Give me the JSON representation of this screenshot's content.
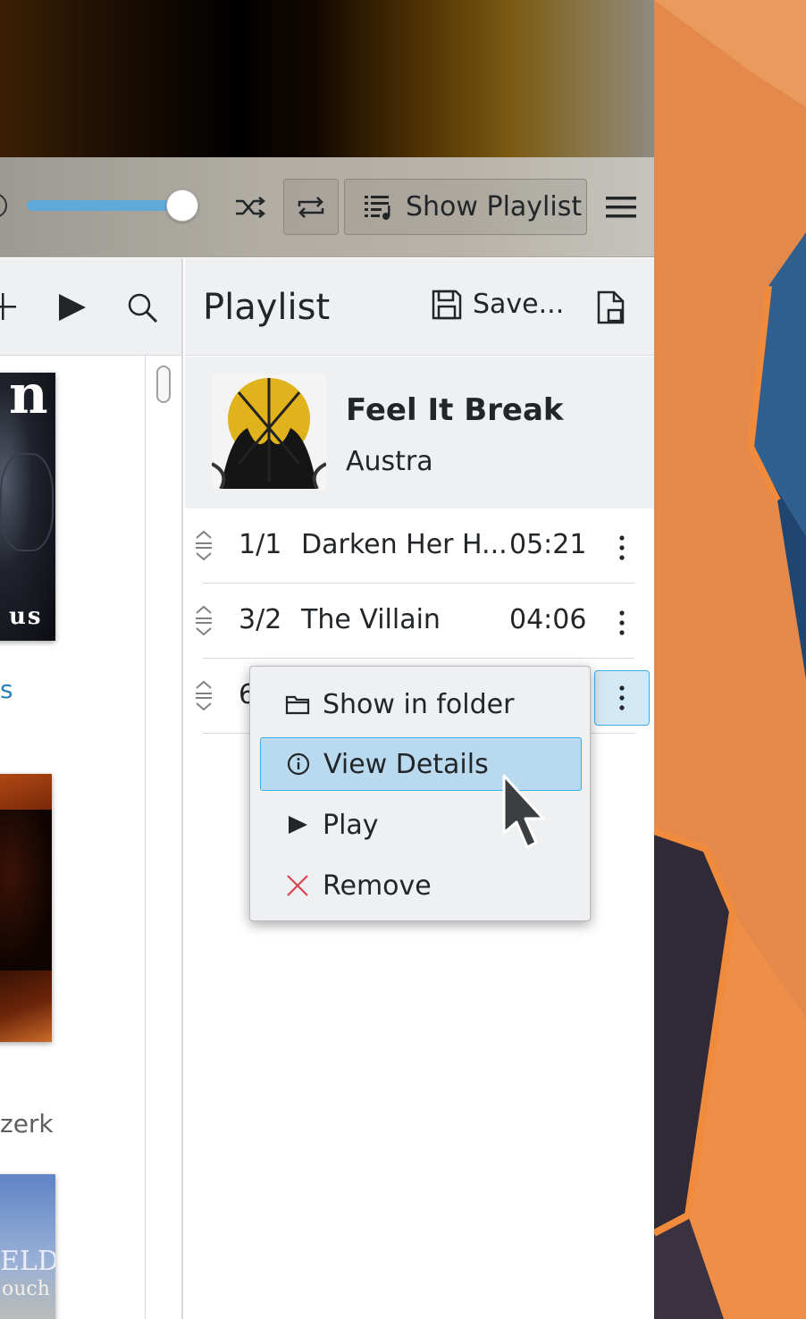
{
  "toolbar": {
    "show_playlist_label": "Show Playlist",
    "volume_level": 0.9
  },
  "left_pane": {
    "caption_partial": "zerk",
    "link_partial": "s",
    "album_1_text": "us",
    "album_3_text_line1": "ELD",
    "album_3_text_line2": "ouch"
  },
  "playlist": {
    "title": "Playlist",
    "save_label": "Save...",
    "now_playing": {
      "title": "Feel It Break",
      "artist": "Austra"
    },
    "tracks": [
      {
        "number": "1/1",
        "title": "Darken Her H...",
        "duration": "05:21"
      },
      {
        "number": "3/2",
        "title": "The Villain",
        "duration": "04:06"
      },
      {
        "number": "6",
        "title": "",
        "duration": ""
      }
    ]
  },
  "context_menu": {
    "items": [
      {
        "label": "Show in folder",
        "icon": "folder-icon"
      },
      {
        "label": "View Details",
        "icon": "info-icon"
      },
      {
        "label": "Play",
        "icon": "play-icon"
      },
      {
        "label": "Remove",
        "icon": "remove-icon"
      }
    ]
  },
  "colors": {
    "accent": "#3daee9",
    "highlight": "#b8d9ee",
    "remove": "#da4453"
  }
}
